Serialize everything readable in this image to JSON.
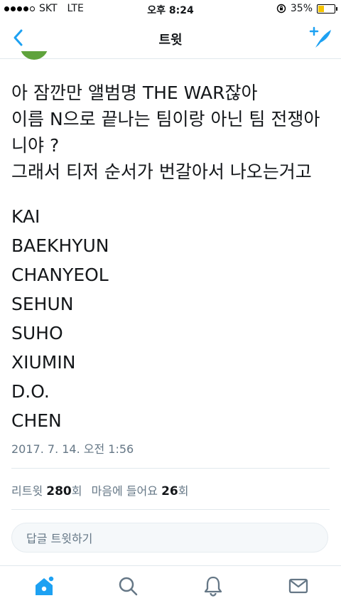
{
  "status_bar": {
    "carrier": "SKT",
    "network": "LTE",
    "time": "오후 8:24",
    "battery_percent": "35%",
    "battery_level": 0.35
  },
  "nav": {
    "title": "트윗",
    "back_icon": "chevron-left-icon",
    "compose_icon": "compose-tweet-icon"
  },
  "tweet": {
    "lines": [
      "아 잠깐만 앨범명 THE WAR잖아",
      "이름 N으로 끝나는 팀이랑 아닌 팀 전쟁아",
      "니야 ?",
      "그래서 티저 순서가 번갈아서 나오는거고"
    ],
    "names": [
      "KAI",
      "BAEKHYUN",
      "CHANYEOL",
      "SEHUN",
      "SUHO",
      "XIUMIN",
      "D.O.",
      "CHEN"
    ],
    "timestamp": "2017. 7. 14. 오전 1:56"
  },
  "stats": {
    "retweet_label": "리트윗",
    "retweet_count": "280",
    "retweet_unit": "회",
    "like_label": "마음에 들어요",
    "like_count": "26",
    "like_unit": "회"
  },
  "reply": {
    "placeholder": "답글 트윗하기"
  },
  "tabbar": {
    "accent": "#1da1f2",
    "tabs": [
      "home-icon",
      "search-icon",
      "notifications-icon",
      "messages-icon"
    ]
  }
}
